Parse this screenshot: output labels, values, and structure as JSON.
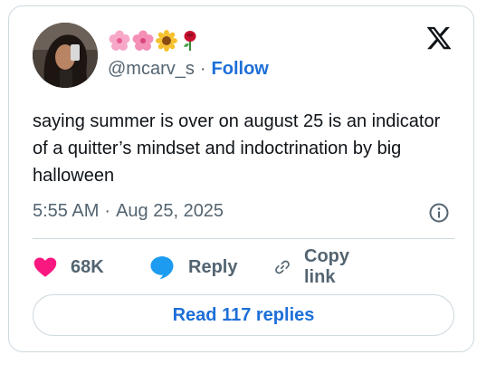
{
  "user": {
    "display_name_emojis": [
      "cherry-blossom",
      "cherry-blossom",
      "sunflower",
      "rose"
    ],
    "handle": "@mcarv_s",
    "separator": "·",
    "follow_label": "Follow"
  },
  "tweet": {
    "text": "saying summer is over on august 25 is an indicator of a quitter’s mindset and indoctrination by big halloween",
    "time": "5:55 AM",
    "separator": "·",
    "date": "Aug 25, 2025"
  },
  "actions": {
    "likes": "68K",
    "reply_label": "Reply",
    "copy_label": "Copy link"
  },
  "read_replies_label": "Read 117 replies",
  "colors": {
    "accent": "#1d6fd8",
    "like": "#f91880",
    "reply": "#1d9bf0",
    "muted": "#536471",
    "border": "#cfd9de"
  }
}
